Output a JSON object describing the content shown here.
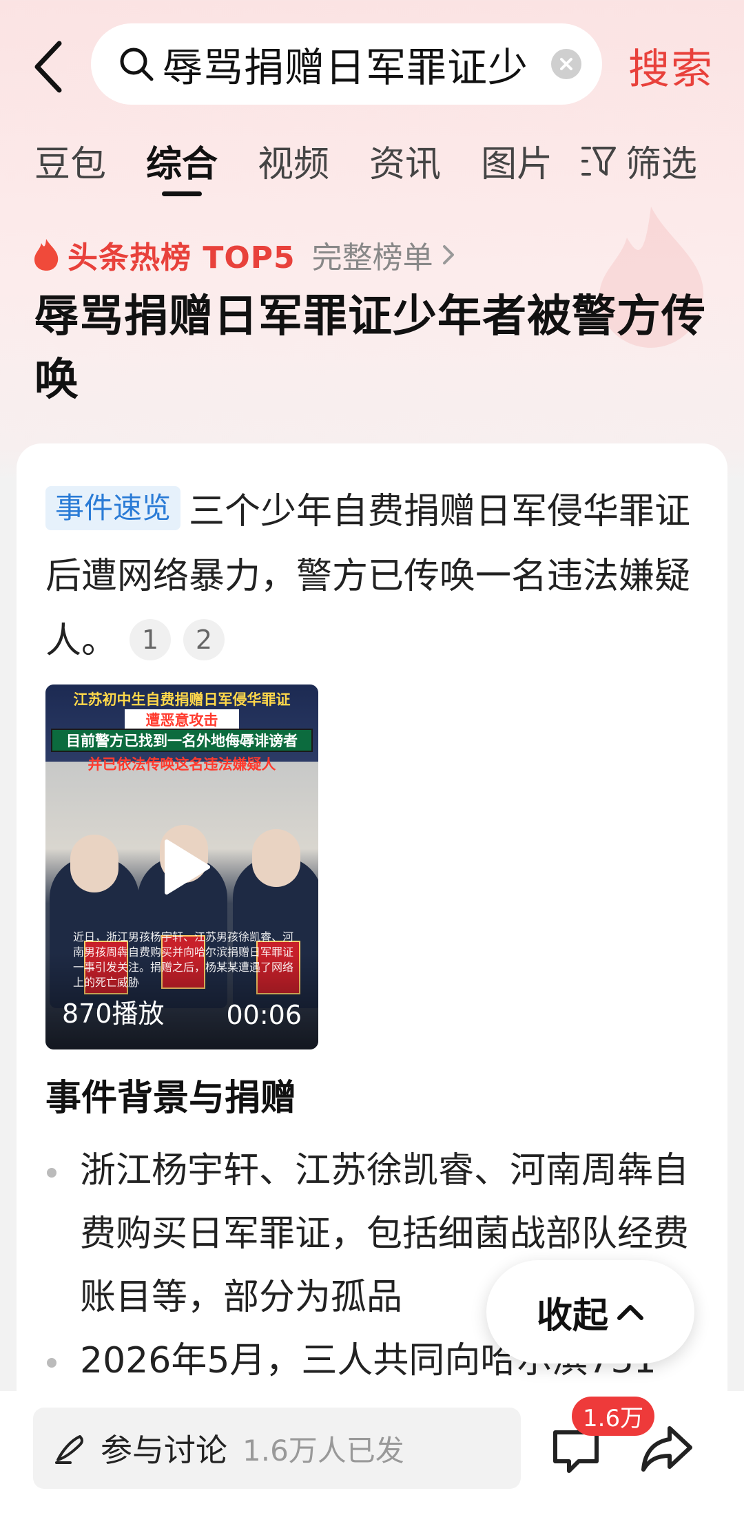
{
  "search": {
    "query": "辱骂捐赠日军罪证少",
    "submit_label": "搜索"
  },
  "tabs": [
    {
      "label": "豆包"
    },
    {
      "label": "综合"
    },
    {
      "label": "视频"
    },
    {
      "label": "资讯"
    },
    {
      "label": "图片"
    }
  ],
  "filter_label": "筛选",
  "hot": {
    "rank_label": "头条热榜 TOP5",
    "full_rank_label": "完整榜单",
    "headline": "辱骂捐赠日军罪证少年者被警方传唤"
  },
  "card": {
    "tag": "事件速览",
    "summary": "三个少年自费捐赠日军侵华罪证后遭网络暴力，警方已传唤一名违法嫌疑人。",
    "citations": [
      "1",
      "2"
    ],
    "video": {
      "caption_line1": "江苏初中生自费捐赠日军侵华罪证",
      "caption_line2": "遭恶意攻击",
      "caption_line3": "目前警方已找到一名外地侮辱诽谤者",
      "caption_line4": "并已依法传唤这名违法嫌疑人",
      "subtitle": "近日，浙江男孩杨宇轩、江苏男孩徐凯睿、河南男孩周犇自费购买并向哈尔滨捐赠日军罪证一事引发关注。捐赠之后，杨某某遭遇了网络上的死亡威胁",
      "play_count": "870播放",
      "duration": "00:06"
    },
    "section_title": "事件背景与捐赠",
    "bullets": [
      "浙江杨宇轩、江苏徐凯睿、河南周犇自费购买日军罪证，包括细菌战部队经费账目等，部分为孤品",
      "2026年5月，三人共同向哈尔滨731"
    ]
  },
  "collapse_label": "收起",
  "bottom": {
    "discuss_label": "参与讨论",
    "discuss_count": "1.6万人已发",
    "comment_badge": "1.6万"
  }
}
